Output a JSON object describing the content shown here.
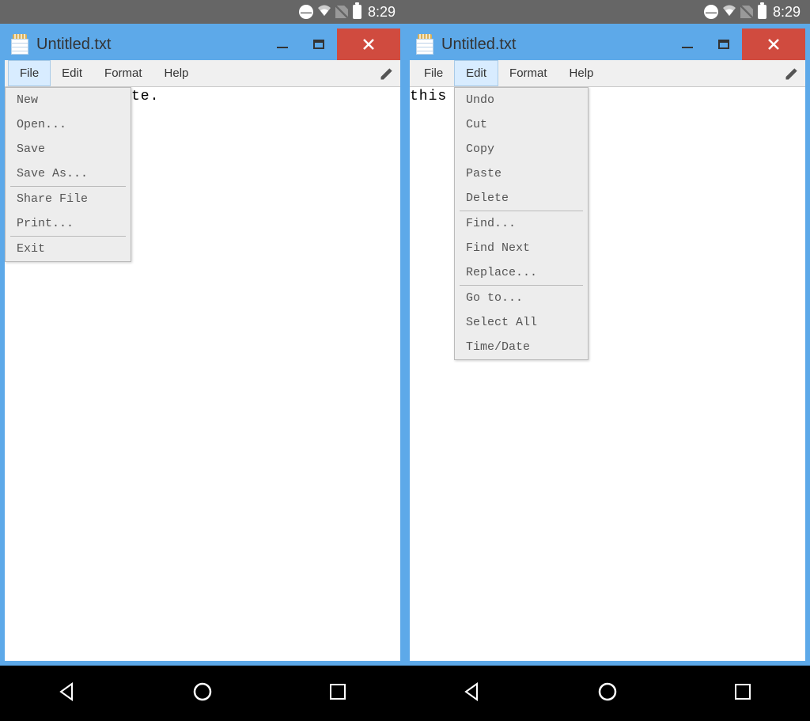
{
  "status": {
    "time": "8:29"
  },
  "window": {
    "title": "Untitled.txt"
  },
  "menubar": {
    "file": "File",
    "edit": "Edit",
    "format": "Format",
    "help": "Help"
  },
  "editor": {
    "left_visible_text": "te.",
    "right_visible_text": "this"
  },
  "file_menu": {
    "new": "New",
    "open": "Open...",
    "save": "Save",
    "save_as": "Save As...",
    "share": "Share File",
    "print": "Print...",
    "exit": "Exit"
  },
  "edit_menu": {
    "undo": "Undo",
    "cut": "Cut",
    "copy": "Copy",
    "paste": "Paste",
    "delete": "Delete",
    "find": "Find...",
    "find_next": "Find Next",
    "replace": "Replace...",
    "goto": "Go to...",
    "select_all": "Select All",
    "time_date": "Time/Date"
  }
}
